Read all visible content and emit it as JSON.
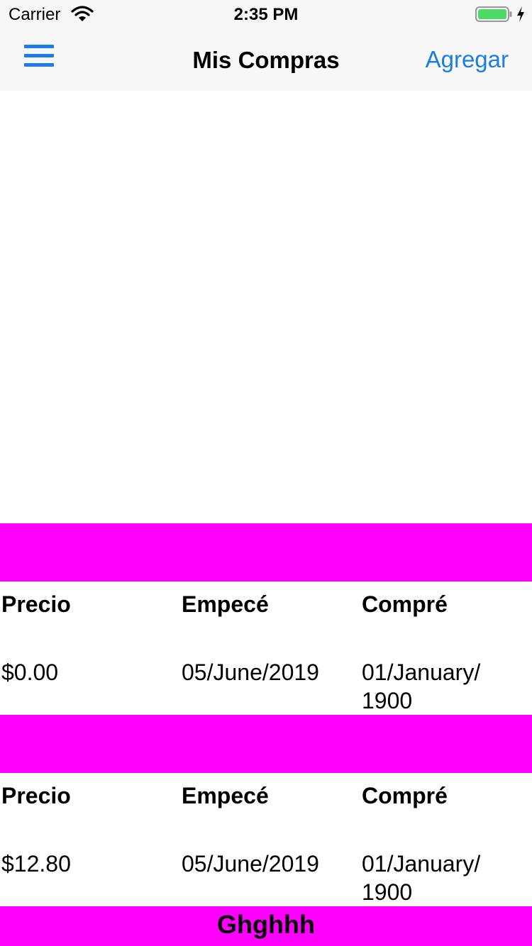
{
  "status_bar": {
    "carrier": "Carrier",
    "time": "2:35 PM",
    "wifi_icon": "wifi-icon",
    "battery_icon": "battery-icon",
    "charging_icon": "bolt-icon",
    "battery_color": "#4cd964"
  },
  "nav": {
    "title": "Mis Compras",
    "add_label": "Agregar",
    "menu_icon": "hamburger-menu-icon",
    "accent_color": "#1a7ee6"
  },
  "purchases": [
    {
      "headers": [
        "Precio",
        "Empecé",
        "Compré"
      ],
      "price": "$0.00",
      "started": "05/June/2019",
      "bought_line1": "01/January/",
      "bought_line2": "1900"
    },
    {
      "headers": [
        "Precio",
        "Empecé",
        "Compré"
      ],
      "price": "$12.80",
      "started": "05/June/2019",
      "bought_line1": "01/January/",
      "bought_line2": "1900"
    }
  ],
  "band_color": "#ff00ff",
  "bottom": {
    "label": "Ghghhh"
  }
}
